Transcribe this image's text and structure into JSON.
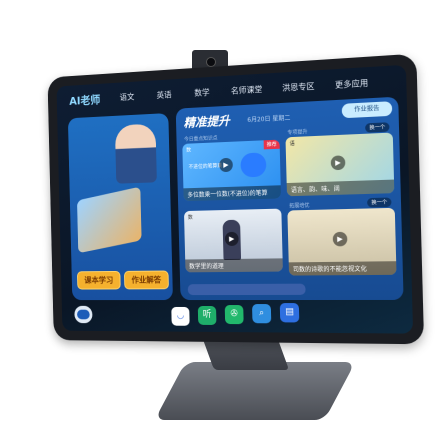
{
  "app": {
    "logo": "AI老师"
  },
  "nav": [
    "语文",
    "英语",
    "数学",
    "名师课堂",
    "洪恩专区",
    "更多应用"
  ],
  "left_panel": {
    "buttons": [
      "课本学习",
      "作业解答"
    ]
  },
  "main": {
    "title": "精准提升",
    "date": "6月20日 星期二",
    "report_button": "作业报告",
    "sections": {
      "today": "今日重点知识点",
      "special": "专项提升",
      "expand": "拓展培优"
    },
    "swap": "换一个",
    "cards": [
      {
        "badge": "数",
        "tag": "推荐",
        "subtitle": "不进位的笔算乘",
        "caption": "多位数乘一位数(不进位)的笔算"
      },
      {
        "badge": "语",
        "caption": "语言、韵、味、阔"
      },
      {
        "badge": "数",
        "caption": "数学里的道理"
      },
      {
        "badge": "",
        "caption": "司数的诗歌的不能忽视文化"
      }
    ]
  },
  "dock": [
    {
      "icon": "app-store-icon",
      "color": "#ffffff"
    },
    {
      "icon": "listen-icon",
      "label": "听",
      "color": "#1fae6a"
    },
    {
      "icon": "film-icon",
      "color": "#22b86c"
    },
    {
      "icon": "search-zoom-icon",
      "color": "#2f8ee0"
    },
    {
      "icon": "book-icon",
      "color": "#2e6fe0"
    }
  ]
}
